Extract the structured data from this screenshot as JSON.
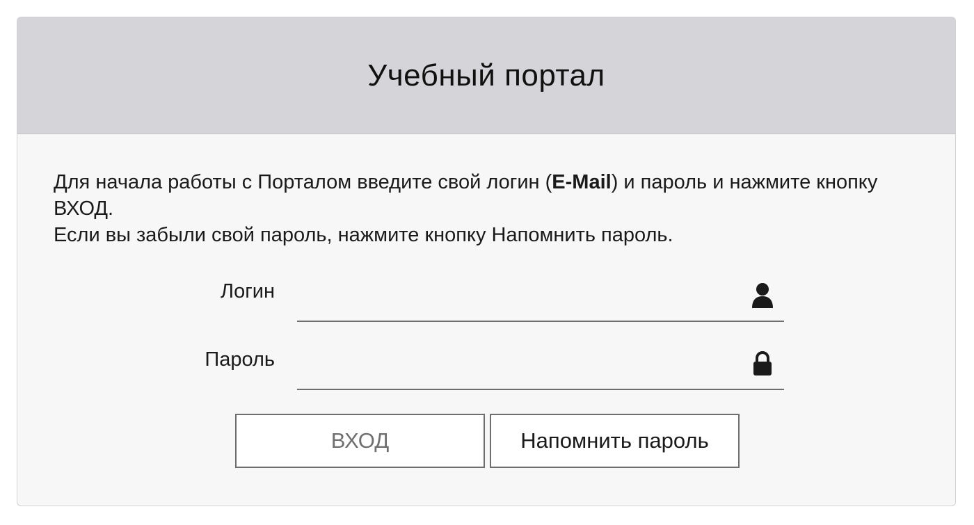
{
  "header": {
    "title": "Учебный портал"
  },
  "intro": {
    "line1_before": "Для начала работы с Порталом введите свой логин (",
    "line1_bold": "E-Mail",
    "line1_after": ") и пароль и нажмите кнопку ВХОД.",
    "line2": "Если вы забыли свой пароль, нажмите кнопку Напомнить пароль."
  },
  "form": {
    "login_label": "Логин",
    "login_value": "",
    "login_icon": "user-icon",
    "password_label": "Пароль",
    "password_value": "",
    "password_icon": "lock-icon"
  },
  "buttons": {
    "login_label": "ВХОД",
    "remind_label": "Напомнить пароль"
  },
  "colors": {
    "header_bg": "#d5d4d8",
    "body_bg": "#f7f7f7",
    "disabled_text": "#6f6f6f"
  }
}
